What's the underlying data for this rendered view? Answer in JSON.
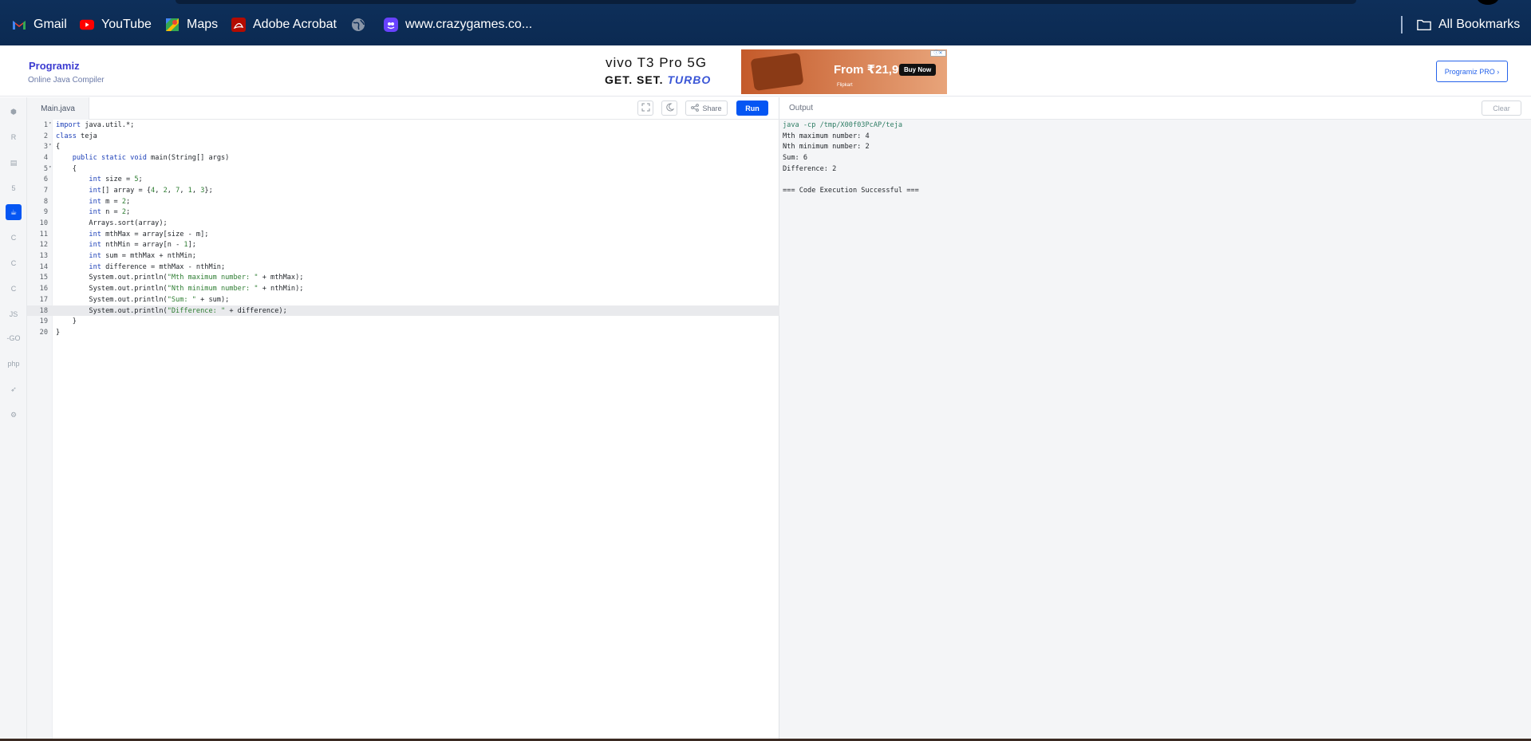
{
  "bookmarks": {
    "items": [
      {
        "label": "Gmail",
        "icon": "gmail-icon"
      },
      {
        "label": "YouTube",
        "icon": "youtube-icon"
      },
      {
        "label": "Maps",
        "icon": "maps-icon"
      },
      {
        "label": "Adobe Acrobat",
        "icon": "acrobat-icon"
      },
      {
        "label": "",
        "icon": "globe-icon"
      },
      {
        "label": "www.crazygames.co...",
        "icon": "crazygames-icon"
      }
    ],
    "all_bookmarks": "All Bookmarks"
  },
  "header": {
    "logo": "Programiz",
    "subtitle": "Online Java Compiler",
    "pro_button": "Programiz PRO ›"
  },
  "ad": {
    "line1": "vivo T3 Pro 5G",
    "line2_prefix": "GET. SET. ",
    "line2_turbo": "TURBO",
    "price": "From ₹21,999*",
    "buy": "Buy Now",
    "store": "Flipkart"
  },
  "editor": {
    "tab": "Main.java",
    "share": "Share",
    "run": "Run",
    "highlighted_line": 18,
    "lines": [
      {
        "n": "1",
        "fold": "▾",
        "code": "import java.util.*;"
      },
      {
        "n": "2",
        "fold": "",
        "code": "class teja"
      },
      {
        "n": "3",
        "fold": "▾",
        "code": "{"
      },
      {
        "n": "4",
        "fold": "",
        "code": "    public static void main(String[] args)"
      },
      {
        "n": "5",
        "fold": "▾",
        "code": "    {"
      },
      {
        "n": "6",
        "fold": "",
        "code": "        int size = 5;"
      },
      {
        "n": "7",
        "fold": "",
        "code": "        int[] array = {4, 2, 7, 1, 3};"
      },
      {
        "n": "8",
        "fold": "",
        "code": "        int m = 2;"
      },
      {
        "n": "9",
        "fold": "",
        "code": "        int n = 2;"
      },
      {
        "n": "10",
        "fold": "",
        "code": "        Arrays.sort(array);"
      },
      {
        "n": "11",
        "fold": "",
        "code": "        int mthMax = array[size - m];"
      },
      {
        "n": "12",
        "fold": "",
        "code": "        int nthMin = array[n - 1];"
      },
      {
        "n": "13",
        "fold": "",
        "code": "        int sum = mthMax + nthMin;"
      },
      {
        "n": "14",
        "fold": "",
        "code": "        int difference = mthMax - nthMin;"
      },
      {
        "n": "15",
        "fold": "",
        "code": "        System.out.println(\"Mth maximum number: \" + mthMax);"
      },
      {
        "n": "16",
        "fold": "",
        "code": "        System.out.println(\"Nth minimum number: \" + nthMin);"
      },
      {
        "n": "17",
        "fold": "",
        "code": "        System.out.println(\"Sum: \" + sum);"
      },
      {
        "n": "18",
        "fold": "",
        "code": "        System.out.println(\"Difference: \" + difference);"
      },
      {
        "n": "19",
        "fold": "",
        "code": "    }"
      },
      {
        "n": "20",
        "fold": "",
        "code": "}"
      }
    ]
  },
  "output": {
    "label": "Output",
    "clear": "Clear",
    "lines": [
      "java -cp /tmp/X00f03PcAP/teja",
      "Mth maximum number: 4",
      "Nth minimum number: 2",
      "Sum: 6",
      "Difference: 2",
      "",
      "=== Code Execution Successful ==="
    ]
  },
  "sidebar": {
    "languages": [
      {
        "name": "python-icon",
        "glyph": "⬢"
      },
      {
        "name": "r-icon",
        "glyph": "R"
      },
      {
        "name": "sql-icon",
        "glyph": "▤"
      },
      {
        "name": "html-icon",
        "glyph": "5"
      },
      {
        "name": "java-icon",
        "glyph": "☕",
        "active": true
      },
      {
        "name": "c-icon",
        "glyph": "C"
      },
      {
        "name": "cpp-icon",
        "glyph": "C"
      },
      {
        "name": "csharp-icon",
        "glyph": "C"
      },
      {
        "name": "javascript-icon",
        "glyph": "JS"
      },
      {
        "name": "go-icon",
        "glyph": "-GO"
      },
      {
        "name": "php-icon",
        "glyph": "php"
      },
      {
        "name": "swift-icon",
        "glyph": "➶"
      },
      {
        "name": "rust-icon",
        "glyph": "⚙"
      }
    ]
  },
  "colors": {
    "accent": "#0556f3",
    "bookmarks_bg": "#0d2d57"
  }
}
